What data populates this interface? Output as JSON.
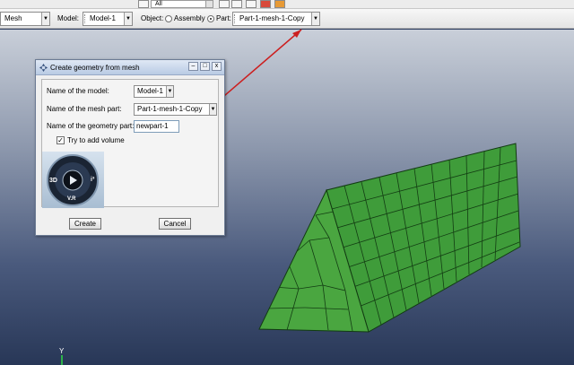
{
  "toolbar": {
    "all_combo": "All",
    "module_value": "Mesh",
    "model_label": "Model:",
    "model_value": "Model-1",
    "object_label": "Object:",
    "assembly_label": "Assembly",
    "part_label": "Part:",
    "part_value": "Part-1-mesh-1-Copy",
    "selected_object": "Part"
  },
  "dialog": {
    "title": "Create geometry from mesh",
    "model_label": "Name of the model:",
    "model_value": "Model-1",
    "mesh_part_label": "Name of the mesh part:",
    "mesh_part_value": "Part-1-mesh-1-Copy",
    "geometry_label": "Name of the geometry part:",
    "geometry_value": "newpart-1",
    "add_volume_label": "Try to add volume",
    "add_volume_checked": true,
    "logo_left": "3D",
    "logo_right": "i³",
    "logo_bottom": "V.R",
    "create_button": "Create",
    "cancel_button": "Cancel",
    "minimize": "–",
    "maximize": "□",
    "close": "x"
  },
  "viewport": {
    "triad_y": "Y",
    "mesh_color": "#3f9c3a"
  },
  "annotation": {
    "arrow_color": "#cc1f1f"
  }
}
